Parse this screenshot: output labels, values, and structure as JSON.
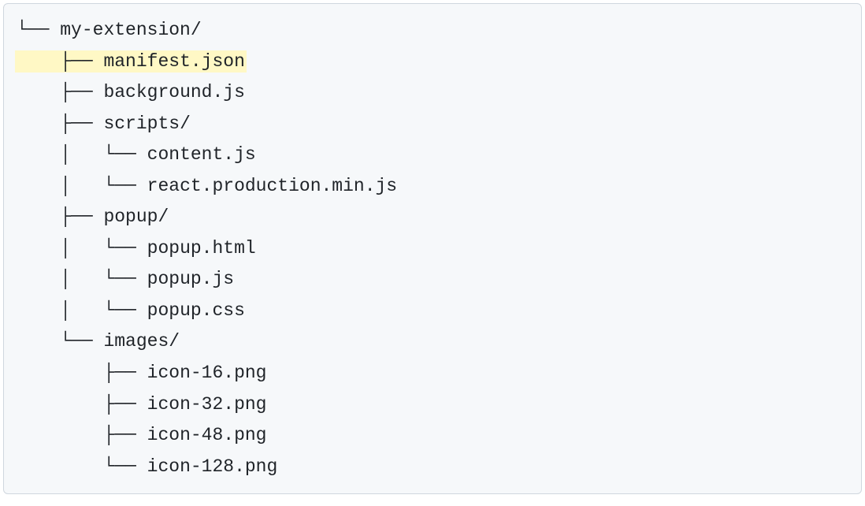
{
  "tree": {
    "lines": [
      {
        "prefix": "└──",
        "indent": "",
        "name": "my-extension/",
        "highlighted": false
      },
      {
        "prefix": "├──",
        "indent": "    ",
        "name": "manifest.json",
        "highlighted": true
      },
      {
        "prefix": "├──",
        "indent": "    ",
        "name": "background.js",
        "highlighted": false
      },
      {
        "prefix": "├──",
        "indent": "    ",
        "name": "scripts/",
        "highlighted": false
      },
      {
        "prefix": "└──",
        "indent": "    │   ",
        "name": "content.js",
        "highlighted": false
      },
      {
        "prefix": "└──",
        "indent": "    │   ",
        "name": "react.production.min.js",
        "highlighted": false
      },
      {
        "prefix": "├──",
        "indent": "    ",
        "name": "popup/",
        "highlighted": false
      },
      {
        "prefix": "└──",
        "indent": "    │   ",
        "name": "popup.html",
        "highlighted": false
      },
      {
        "prefix": "└──",
        "indent": "    │   ",
        "name": "popup.js",
        "highlighted": false
      },
      {
        "prefix": "└──",
        "indent": "    │   ",
        "name": "popup.css",
        "highlighted": false
      },
      {
        "prefix": "└──",
        "indent": "    ",
        "name": "images/",
        "highlighted": false
      },
      {
        "prefix": "├──",
        "indent": "        ",
        "name": "icon-16.png",
        "highlighted": false
      },
      {
        "prefix": "├──",
        "indent": "        ",
        "name": "icon-32.png",
        "highlighted": false
      },
      {
        "prefix": "├──",
        "indent": "        ",
        "name": "icon-48.png",
        "highlighted": false
      },
      {
        "prefix": "└──",
        "indent": "        ",
        "name": "icon-128.png",
        "highlighted": false
      }
    ]
  }
}
